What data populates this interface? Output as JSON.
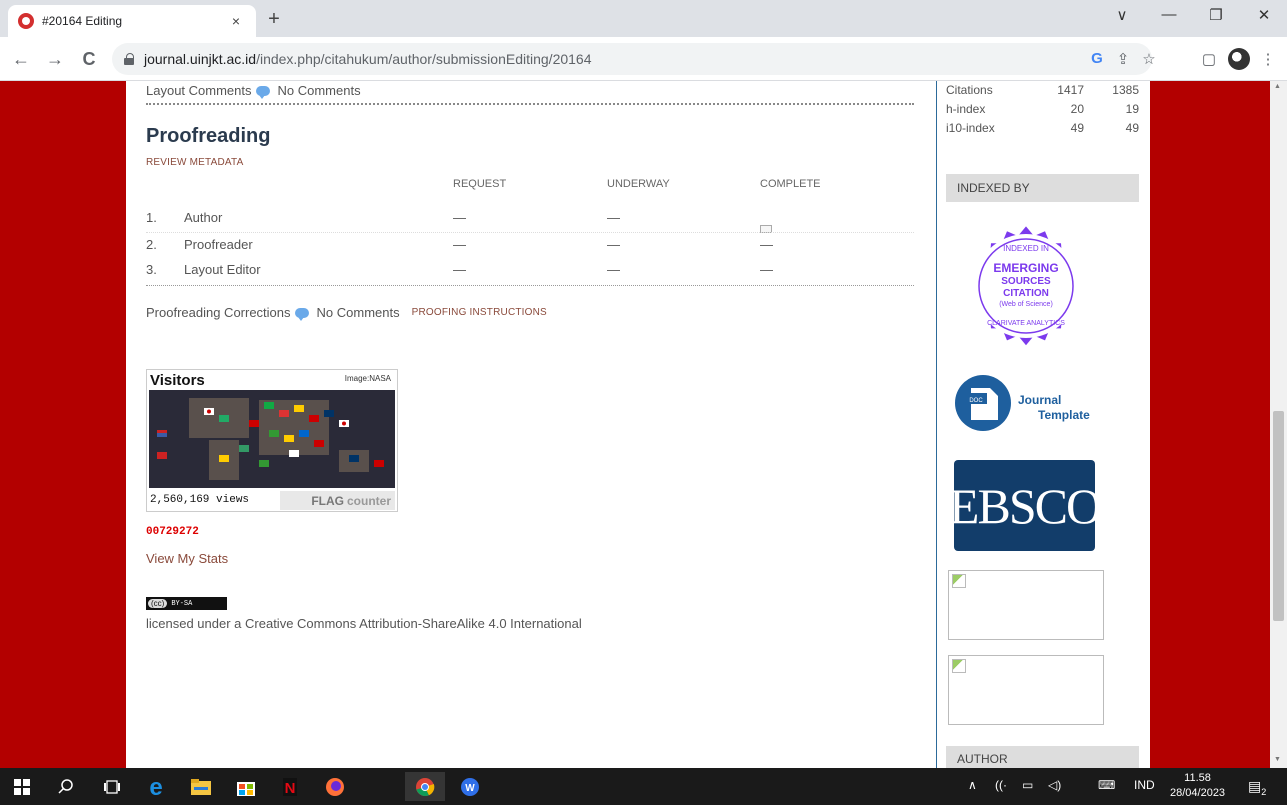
{
  "browser": {
    "tab_title": "#20164 Editing",
    "close_glyph": "×",
    "new_tab_glyph": "+",
    "url_host": "journal.uinjkt.ac.id",
    "url_path": "/index.php/citahukum/author/submissionEditing/20164",
    "window_controls": [
      "∨",
      "—",
      "❐",
      "✕"
    ],
    "nav": {
      "back": "←",
      "forward": "→",
      "reload": "C"
    },
    "toolbar_icons": {
      "google": "G",
      "share": "⇪",
      "bookmark": "☆",
      "sidepanel": "▢",
      "menu": "⋮"
    }
  },
  "main": {
    "layout_comments_label": "Layout Comments",
    "layout_comments_value": "No Comments",
    "section_title": "Proofreading",
    "review_metadata_link": "REVIEW METADATA",
    "columns": [
      "REQUEST",
      "UNDERWAY",
      "COMPLETE"
    ],
    "rows": [
      {
        "num": "1.",
        "role": "Author",
        "request": "—",
        "underway": "—",
        "complete": "mail"
      },
      {
        "num": "2.",
        "role": "Proofreader",
        "request": "—",
        "underway": "—",
        "complete": "—"
      },
      {
        "num": "3.",
        "role": "Layout Editor",
        "request": "—",
        "underway": "—",
        "complete": "—"
      }
    ],
    "corrections_label": "Proofreading Corrections",
    "corrections_value": "No Comments",
    "proofing_instructions_link": "PROOFING INSTRUCTIONS",
    "flag_counter": {
      "title": "Visitors",
      "image_credit": "Image:NASA",
      "views": "2,560,169 views",
      "brand": "FLAG",
      "brand_suffix": "counter"
    },
    "counter_number": "00729272",
    "view_stats_link": "View My Stats",
    "cc_badge": {
      "cc": "(cc)",
      "text": "BY-SA"
    },
    "license_text": "licensed under a Creative Commons Attribution-ShareAlike 4.0 International"
  },
  "sidebar": {
    "citations": [
      {
        "label": "Citations",
        "all": "1417",
        "since": "1385"
      },
      {
        "label": "h-index",
        "all": "20",
        "since": "19"
      },
      {
        "label": "i10-index",
        "all": "49",
        "since": "49"
      }
    ],
    "indexed_by_heading": "INDEXED BY",
    "seal": {
      "line1": "INDEXED IN",
      "line2": "EMERGING",
      "line3": "SOURCES",
      "line4": "CITATION",
      "line5": "(Web of Science)",
      "line6": "CLARIVATE ANALYTICS"
    },
    "journal_template": {
      "line1": "Journal",
      "line2": "Template",
      "badge": "DOC"
    },
    "ebsco": "EBSCO",
    "author_heading": "AUTHOR"
  },
  "taskbar": {
    "lang": "IND",
    "time": "11.58",
    "date": "28/04/2023",
    "notifications": "2"
  },
  "colors": {
    "background": "#b30000",
    "link": "#8a4a3b",
    "heading": "#2b3b4e",
    "sidebar_rule": "#2c6a9a",
    "ebsco_bg": "#123d6a",
    "seal_purple": "#7c3aed"
  }
}
